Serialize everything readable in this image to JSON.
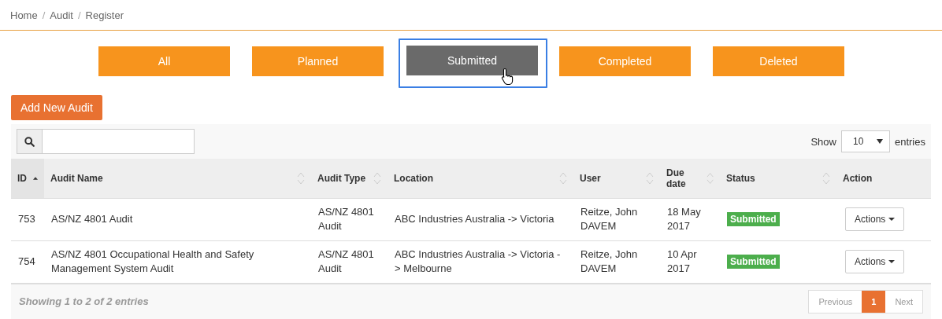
{
  "breadcrumb": [
    "Home",
    "Audit",
    "Register"
  ],
  "breadcrumb_separator": "/",
  "tabs": [
    {
      "label": "All",
      "selected": false
    },
    {
      "label": "Planned",
      "selected": false
    },
    {
      "label": "Submitted",
      "selected": true
    },
    {
      "label": "Completed",
      "selected": false
    },
    {
      "label": "Deleted",
      "selected": false
    }
  ],
  "add_button": "Add New Audit",
  "length_menu": {
    "before": "Show",
    "value": "10",
    "after": "entries"
  },
  "table": {
    "columns": [
      {
        "label": "ID",
        "sortable": true,
        "sorted": true
      },
      {
        "label": "Audit Name",
        "sortable": true,
        "sorted": false
      },
      {
        "label": "Audit Type",
        "sortable": true,
        "sorted": false
      },
      {
        "label": "Location",
        "sortable": true,
        "sorted": false
      },
      {
        "label": "User",
        "sortable": true,
        "sorted": false
      },
      {
        "label": "Due date",
        "sortable": true,
        "sorted": false
      },
      {
        "label": "Status",
        "sortable": true,
        "sorted": false
      },
      {
        "label": "Action",
        "sortable": false,
        "sorted": false
      }
    ],
    "rows": [
      {
        "id": "753",
        "name": "AS/NZ 4801 Audit",
        "type": "AS/NZ 4801 Audit",
        "location": "ABC Industries Australia -> Victoria",
        "user": "Reitze, John DAVEM",
        "due": "18 May 2017",
        "status": "Submitted",
        "action": "Actions"
      },
      {
        "id": "754",
        "name": "AS/NZ 4801 Occupational Health and Safety Management System Audit",
        "type": "AS/NZ 4801 Audit",
        "location": "ABC Industries Australia -> Victoria - > Melbourne",
        "user": "Reitze, John DAVEM",
        "due": "10 Apr 2017",
        "status": "Submitted",
        "action": "Actions"
      }
    ]
  },
  "info": "Showing 1 to 2 of 2 entries",
  "pagination": [
    {
      "label": "Previous",
      "disabled": true,
      "selected": false
    },
    {
      "label": "1",
      "disabled": false,
      "selected": true
    },
    {
      "label": "Next",
      "disabled": true,
      "selected": false
    }
  ]
}
